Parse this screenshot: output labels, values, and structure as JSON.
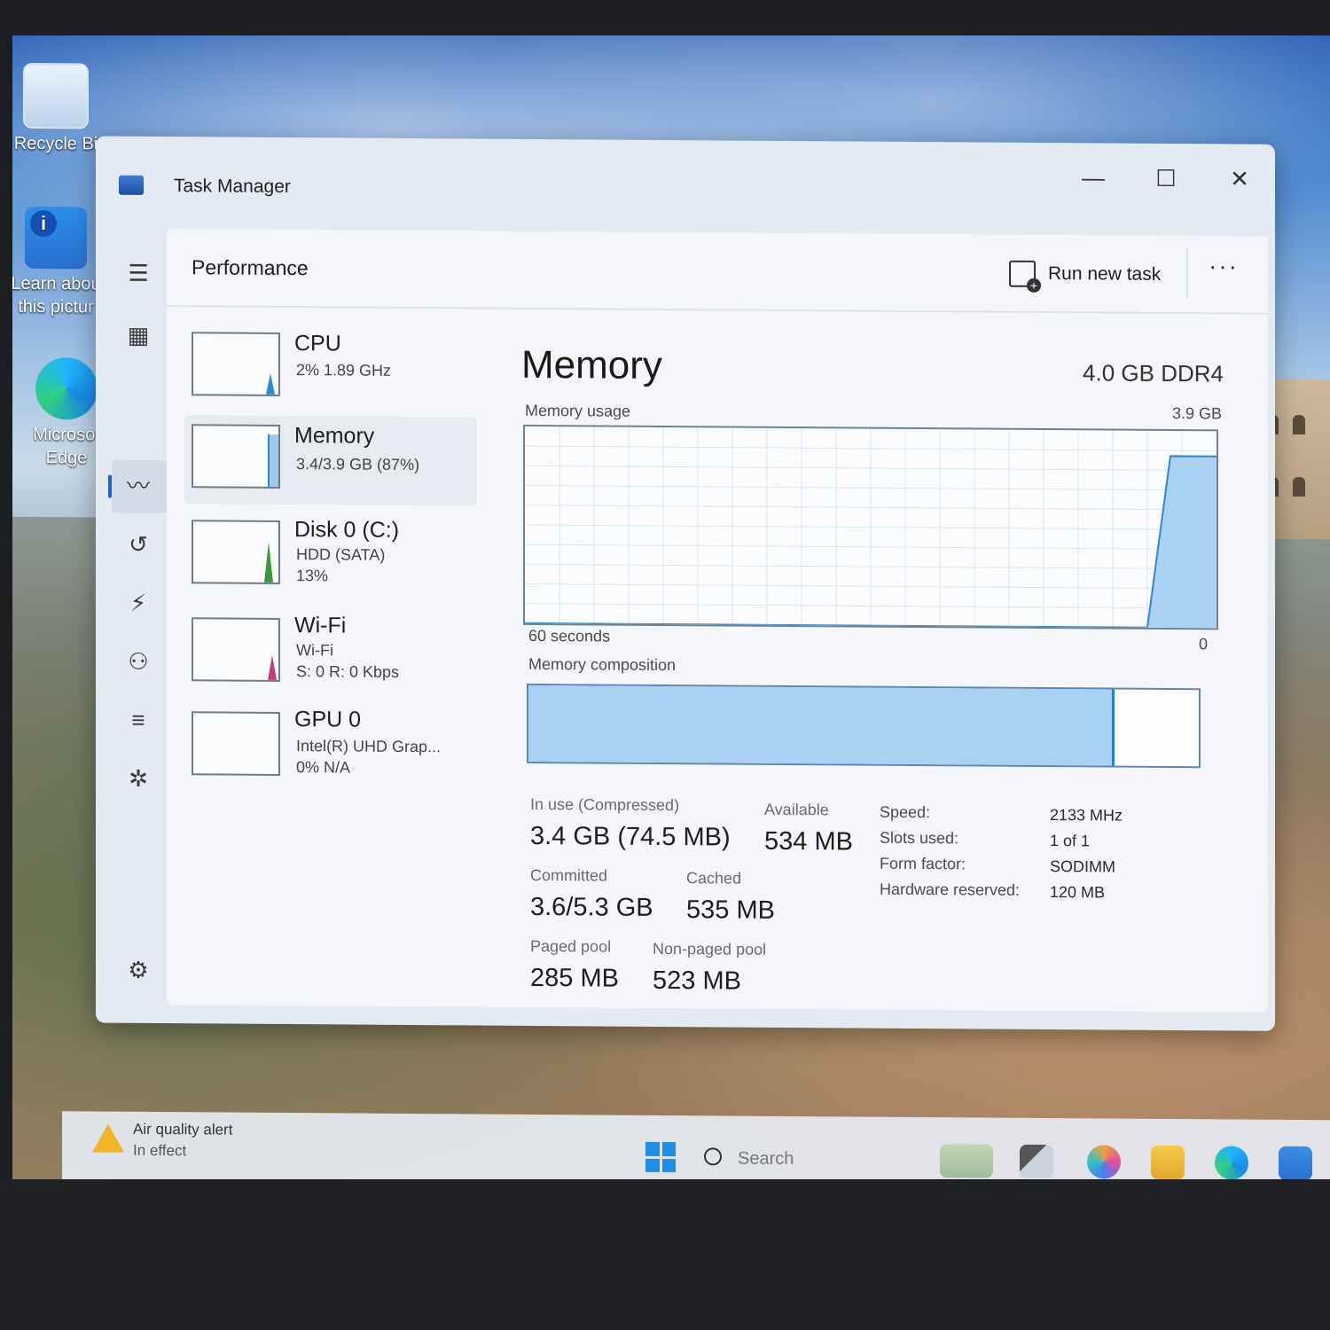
{
  "desktop": {
    "icons": [
      {
        "label": "Recycle Bi"
      },
      {
        "label": "Learn abou this pictur"
      },
      {
        "label": "Microsof Edge"
      }
    ]
  },
  "window": {
    "title": "Task Manager",
    "minimize_glyph": "—",
    "maximize_glyph": "☐",
    "close_glyph": "✕"
  },
  "nav_rail": {
    "icons": [
      "hamburger-icon",
      "processes-icon",
      "performance-icon",
      "app-history-icon",
      "startup-apps-icon",
      "users-icon",
      "details-icon",
      "services-icon",
      "settings-icon"
    ],
    "active": "performance-icon"
  },
  "header": {
    "page_title": "Performance",
    "run_new_task": "Run new task",
    "more": "···"
  },
  "perf_list": [
    {
      "name": "CPU",
      "sub1": "2% 1.89 GHz",
      "sub2": "",
      "sub3": "",
      "level_pct": 2,
      "accent": "#2f86d6"
    },
    {
      "name": "Memory",
      "sub1": "3.4/3.9 GB (87%)",
      "sub2": "",
      "sub3": "",
      "level_pct": 87,
      "accent": "#2f86d6"
    },
    {
      "name": "Disk 0 (C:)",
      "sub1": "HDD (SATA)",
      "sub2": "13%",
      "sub3": "",
      "level_pct": 13,
      "accent": "#3a9a3a"
    },
    {
      "name": "Wi-Fi",
      "sub1": "Wi-Fi",
      "sub2": "S: 0 R: 0 Kbps",
      "sub3": "",
      "level_pct": 0,
      "accent": "#c23b7a"
    },
    {
      "name": "GPU 0",
      "sub1": "Intel(R) UHD Grap...",
      "sub2": "0% N/A",
      "sub3": "",
      "level_pct": 0,
      "accent": "#2f86d6"
    }
  ],
  "selected_item": "Memory",
  "detail": {
    "title": "Memory",
    "spec": "4.0 GB DDR4",
    "usage_label": "Memory usage",
    "usage_max": "3.9 GB",
    "time_span": "60 seconds",
    "time_end": "0",
    "composition_label": "Memory composition",
    "composition_in_use_fraction": 0.87,
    "stats": {
      "in_use_label": "In use (Compressed)",
      "in_use_value": "3.4 GB (74.5 MB)",
      "available_label": "Available",
      "available_value": "534 MB",
      "committed_label": "Committed",
      "committed_value": "3.6/5.3 GB",
      "cached_label": "Cached",
      "cached_value": "535 MB",
      "paged_pool_label": "Paged pool",
      "paged_pool_value": "285 MB",
      "non_paged_pool_label": "Non-paged pool",
      "non_paged_pool_value": "523 MB"
    },
    "specs_table": [
      {
        "label": "Speed:",
        "value": "2133 MHz"
      },
      {
        "label": "Slots used:",
        "value": "1 of 1"
      },
      {
        "label": "Form factor:",
        "value": "SODIMM"
      },
      {
        "label": "Hardware reserved:",
        "value": "120 MB"
      }
    ]
  },
  "chart_data": {
    "type": "area",
    "x": [
      0,
      54,
      56,
      60
    ],
    "values": [
      0,
      0,
      3.4,
      3.4
    ],
    "xlabel": "60 seconds",
    "ylim": [
      0,
      3.9
    ],
    "grid": true
  },
  "taskbar": {
    "alert_title": "Air quality alert",
    "alert_sub": "In effect",
    "search_placeholder": "Search"
  }
}
